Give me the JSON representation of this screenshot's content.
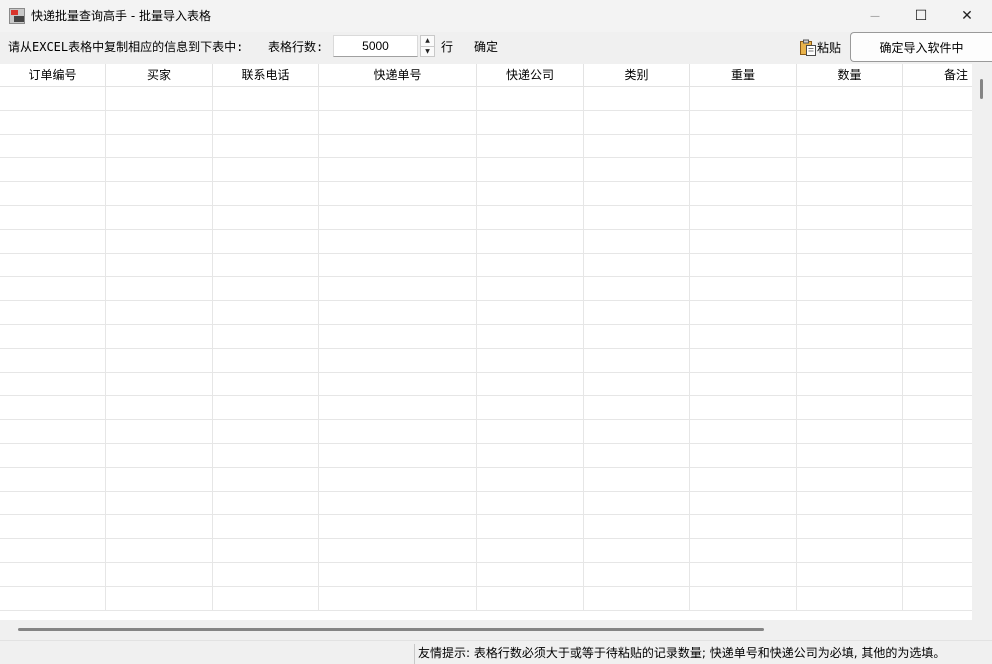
{
  "window": {
    "title": "快递批量查询高手 - 批量导入表格",
    "minimize_glyph": "—",
    "maximize_glyph": "☐",
    "close_glyph": "✕"
  },
  "toolbar": {
    "instruction": "请从EXCEL表格中复制相应的信息到下表中:",
    "rows_label": "表格行数:",
    "rows_value": "5000",
    "rows_unit": "行",
    "confirm_label": "确定",
    "paste_label": "粘贴",
    "import_label": "确定导入软件中"
  },
  "table": {
    "columns": [
      "订单编号",
      "买家",
      "联系电话",
      "快递单号",
      "快递公司",
      "类别",
      "重量",
      "数量",
      "备注"
    ],
    "empty_row_count": 22
  },
  "status": {
    "tip": "友情提示: 表格行数必须大于或等于待粘贴的记录数量; 快递单号和快递公司为必填, 其他的为选填。"
  },
  "icons": {
    "app": "app-icon",
    "paste": "clipboard-icon"
  }
}
